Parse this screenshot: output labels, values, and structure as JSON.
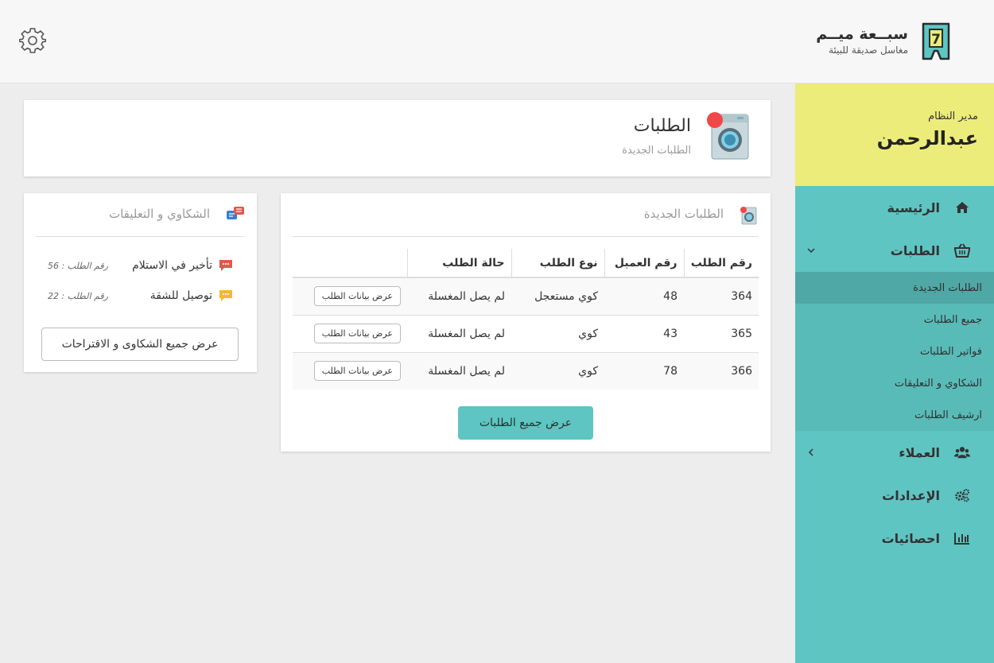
{
  "brand": {
    "name": "سبــعة ميــم",
    "tagline": "مغاسل صديقة للبيئة",
    "logo_digit": "7"
  },
  "user": {
    "role": "مدير النظام",
    "name": "عبدالرحمن"
  },
  "sidebar": {
    "home": "الرئيسية",
    "orders": "الطلبات",
    "orders_sub": [
      "الطلبات الجديدة",
      "جميع الطلبات",
      "فواتير الطلبات",
      "الشكاوي و التعليقات",
      "ارشيف الطلبات"
    ],
    "clients": "العملاء",
    "settings": "الإعدادات",
    "stats": "احصائيات"
  },
  "page": {
    "title": "الطلبات",
    "subtitle": "الطلبات الجديدة"
  },
  "orders_card": {
    "title": "الطلبات الجديدة",
    "columns": [
      "رقم الطلب",
      "رقم العميل",
      "نوع الطلب",
      "حالة الطلب",
      ""
    ],
    "rows": [
      {
        "id": "364",
        "client": "48",
        "type": "كوي مستعجل",
        "status": "لم يصل المغسلة",
        "action": "عرض بيانات الطلب"
      },
      {
        "id": "365",
        "client": "43",
        "type": "كوي",
        "status": "لم يصل المغسلة",
        "action": "عرض بيانات الطلب"
      },
      {
        "id": "366",
        "client": "78",
        "type": "كوي",
        "status": "لم يصل المغسلة",
        "action": "عرض بيانات الطلب"
      }
    ],
    "view_all": "عرض جميع الطلبات"
  },
  "complaints_card": {
    "title": "الشكاوي و التعليقات",
    "items": [
      {
        "text": "تأخير في الاستلام",
        "order": "رقم الطلب : 56",
        "color": "#e2574c"
      },
      {
        "text": "توصيل للشقة",
        "order": "رقم الطلب : 22",
        "color": "#f5b82e"
      }
    ],
    "view_all": "عرض جميع الشكاوى و الاقتراحات"
  },
  "colors": {
    "teal": "#5ec5c2",
    "yellow": "#ecec7a",
    "active_sub": "#4fa8a5",
    "alert_dot": "#f04848"
  }
}
